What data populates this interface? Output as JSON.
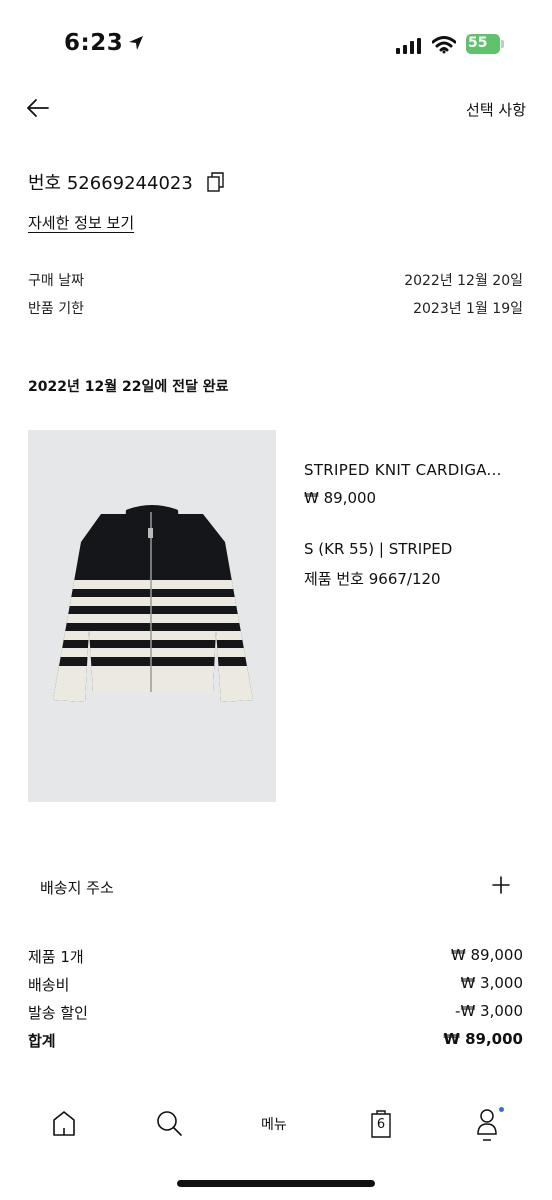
{
  "status_bar": {
    "time": "6:23",
    "battery": "55"
  },
  "header": {
    "options_label": "선택 사항"
  },
  "order": {
    "number_label": "번호 52669244023",
    "details_link": "자세한 정보 보기",
    "purchase_date_label": "구매 날짜",
    "purchase_date_value": "2022년 12월 20일",
    "return_deadline_label": "반품 기한",
    "return_deadline_value": "2023년 1월 19일",
    "delivery_status": "2022년 12월 22일에 전달 완료"
  },
  "product": {
    "name": "STRIPED KNIT CARDIGA...",
    "price": "₩ 89,000",
    "variant": "S (KR 55) | STRIPED",
    "code": "제품 번호 9667/120"
  },
  "address": {
    "label": "배송지 주소"
  },
  "summary": {
    "items_label": "제품 1개",
    "items_value": "₩ 89,000",
    "shipping_label": "배송비",
    "shipping_value": "₩ 3,000",
    "discount_label": "발송 할인",
    "discount_value": "-₩ 3,000",
    "total_label": "합계",
    "total_value": "₩ 89,000"
  },
  "bottom_nav": {
    "menu_label": "메뉴",
    "cart_count": "6"
  },
  "colors": {
    "battery_green": "#5ec36a",
    "notification_dot": "#2f6fe0",
    "image_background": "#e6e7e9"
  }
}
